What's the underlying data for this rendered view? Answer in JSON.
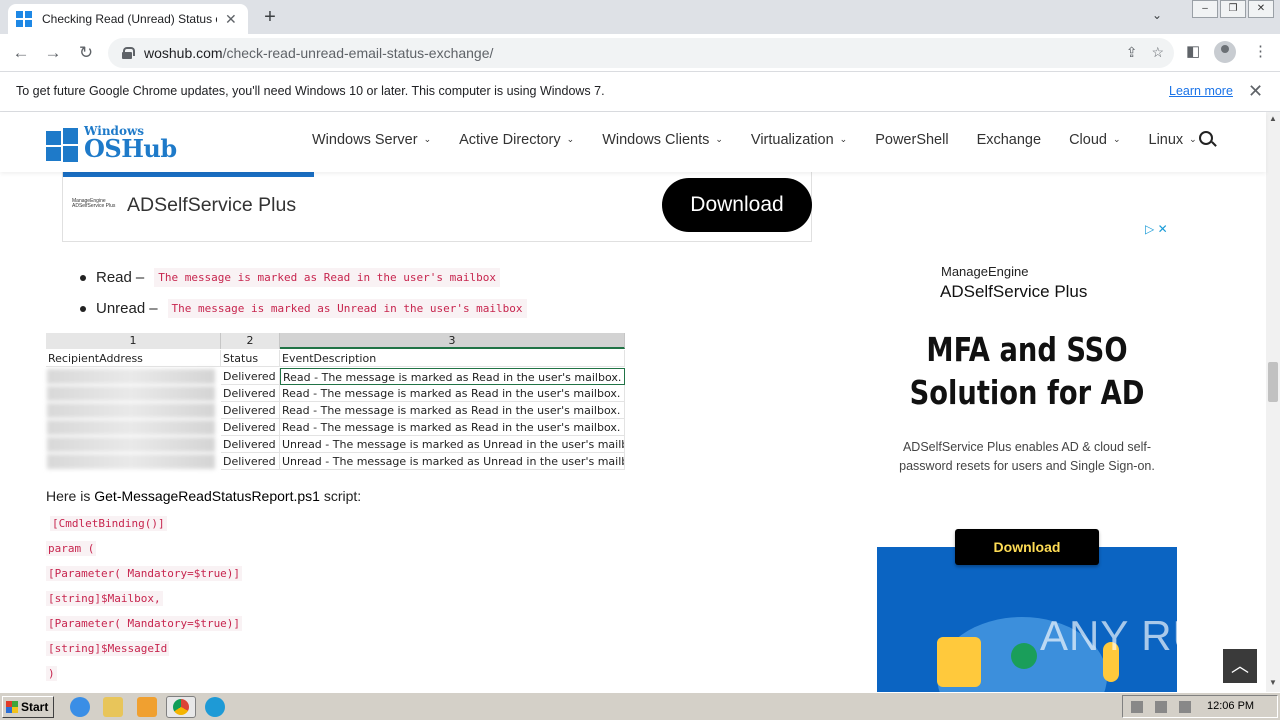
{
  "browser": {
    "tab_title": "Checking Read (Unread) Status of E",
    "url_domain": "woshub.com",
    "url_path": "/check-read-unread-email-status-exchange/"
  },
  "infobar": {
    "message": "To get future Google Chrome updates, you'll need Windows 10 or later. This computer is using Windows 7.",
    "learn_more": "Learn more"
  },
  "site": {
    "logo_top": "Windows",
    "logo_bottom": "OSHub",
    "nav": [
      {
        "label": "Windows Server",
        "has_dropdown": true
      },
      {
        "label": "Active Directory",
        "has_dropdown": true
      },
      {
        "label": "Windows Clients",
        "has_dropdown": true
      },
      {
        "label": "Virtualization",
        "has_dropdown": true
      },
      {
        "label": "PowerShell",
        "has_dropdown": false
      },
      {
        "label": "Exchange",
        "has_dropdown": false
      },
      {
        "label": "Cloud",
        "has_dropdown": true
      },
      {
        "label": "Linux",
        "has_dropdown": true
      }
    ]
  },
  "ad_top": {
    "product": "ADSelfService Plus",
    "button": "Download"
  },
  "article": {
    "bullets": [
      {
        "term": "Read",
        "code": "The message is marked as Read in the user's mailbox"
      },
      {
        "term": "Unread",
        "code": "The message is marked as Unread in the user's mailbox"
      }
    ],
    "sheet": {
      "col_numbers": [
        "1",
        "2",
        "3"
      ],
      "headers": [
        "RecipientAddress",
        "Status",
        "EventDescription"
      ],
      "rows": [
        [
          "Delivered",
          "Read - The message is marked as Read in the user's mailbox."
        ],
        [
          "Delivered",
          "Read - The message is marked as Read in the user's mailbox."
        ],
        [
          "Delivered",
          "Read - The message is marked as Read in the user's mailbox."
        ],
        [
          "Delivered",
          "Read - The message is marked as Read in the user's mailbox."
        ],
        [
          "Delivered",
          "Unread - The message is marked as Unread in the user's mailbox"
        ],
        [
          "Delivered",
          "Unread - The message is marked as Unread in the user's mailbox"
        ]
      ]
    },
    "script_intro": "Here is",
    "script_name": "Get-MessageReadStatusReport.ps1",
    "script_suffix": "script:",
    "code_lines": [
      "[CmdletBinding()]",
      "param (",
      "[Parameter( Mandatory=$true)]",
      "[string]$Mailbox,",
      "[Parameter( Mandatory=$true)]",
      "[string]$MessageId",
      ")"
    ]
  },
  "ad_side": {
    "vendor": "ManageEngine",
    "product": "ADSelfService Plus",
    "headline_1": "MFA and SSO",
    "headline_2": "Solution for AD",
    "sub_1": "ADSelfService Plus enables AD & cloud self-",
    "sub_2": "password resets for users and Single Sign-on.",
    "button": "Download"
  },
  "watermark": "ANY RUN",
  "taskbar": {
    "start": "Start",
    "time": "12:06 PM"
  }
}
